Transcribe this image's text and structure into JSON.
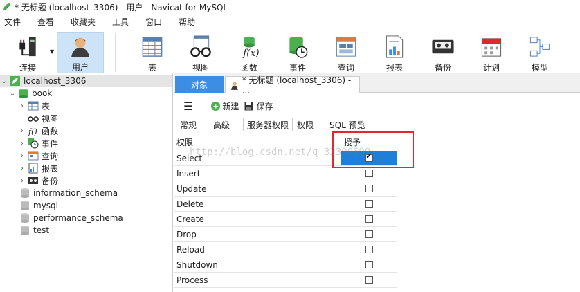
{
  "window": {
    "title": "* 无标题 (localhost_3306) - 用户 - Navicat for MySQL"
  },
  "menu": [
    "文件",
    "查看",
    "收藏夹",
    "工具",
    "窗口",
    "帮助"
  ],
  "toolbar": {
    "items": [
      {
        "label": "连接",
        "icon": "plug-icon"
      },
      {
        "label": "用户",
        "icon": "user-icon"
      },
      {
        "label": "表",
        "icon": "table-icon"
      },
      {
        "label": "视图",
        "icon": "glasses-icon"
      },
      {
        "label": "函数",
        "icon": "function-icon"
      },
      {
        "label": "事件",
        "icon": "clock-db-icon"
      },
      {
        "label": "查询",
        "icon": "query-icon"
      },
      {
        "label": "报表",
        "icon": "report-icon"
      },
      {
        "label": "备份",
        "icon": "tape-icon"
      },
      {
        "label": "计划",
        "icon": "calendar-icon"
      },
      {
        "label": "模型",
        "icon": "model-icon"
      }
    ]
  },
  "tree": {
    "connection": "localhost_3306",
    "db_open": "book",
    "nodes": [
      "表",
      "视图",
      "函数",
      "事件",
      "查询",
      "报表",
      "备份"
    ],
    "dbs": [
      "information_schema",
      "mysql",
      "performance_schema",
      "test"
    ]
  },
  "tabs": {
    "object": "对象",
    "doc": "* 无标题 (localhost_3306) - ..."
  },
  "subtool": {
    "new": "新建",
    "save": "保存"
  },
  "subtabs": [
    "常规",
    "高级",
    "服务器权限",
    "权限",
    "SQL 预览"
  ],
  "grid": {
    "col1": "权限",
    "col2": "授予",
    "rows": [
      {
        "name": "Select",
        "granted": true
      },
      {
        "name": "Insert",
        "granted": false
      },
      {
        "name": "Update",
        "granted": false
      },
      {
        "name": "Delete",
        "granted": false
      },
      {
        "name": "Create",
        "granted": false
      },
      {
        "name": "Drop",
        "granted": false
      },
      {
        "name": "Reload",
        "granted": false
      },
      {
        "name": "Shutdown",
        "granted": false
      },
      {
        "name": "Process",
        "granted": false
      }
    ]
  },
  "watermark": "http://blog.csdn.net/q  32300699",
  "colors": {
    "accent": "#3b8ee4",
    "selection": "#1e7fd8",
    "highlight": "#e0282e",
    "active_tool": "#cde3f7"
  }
}
